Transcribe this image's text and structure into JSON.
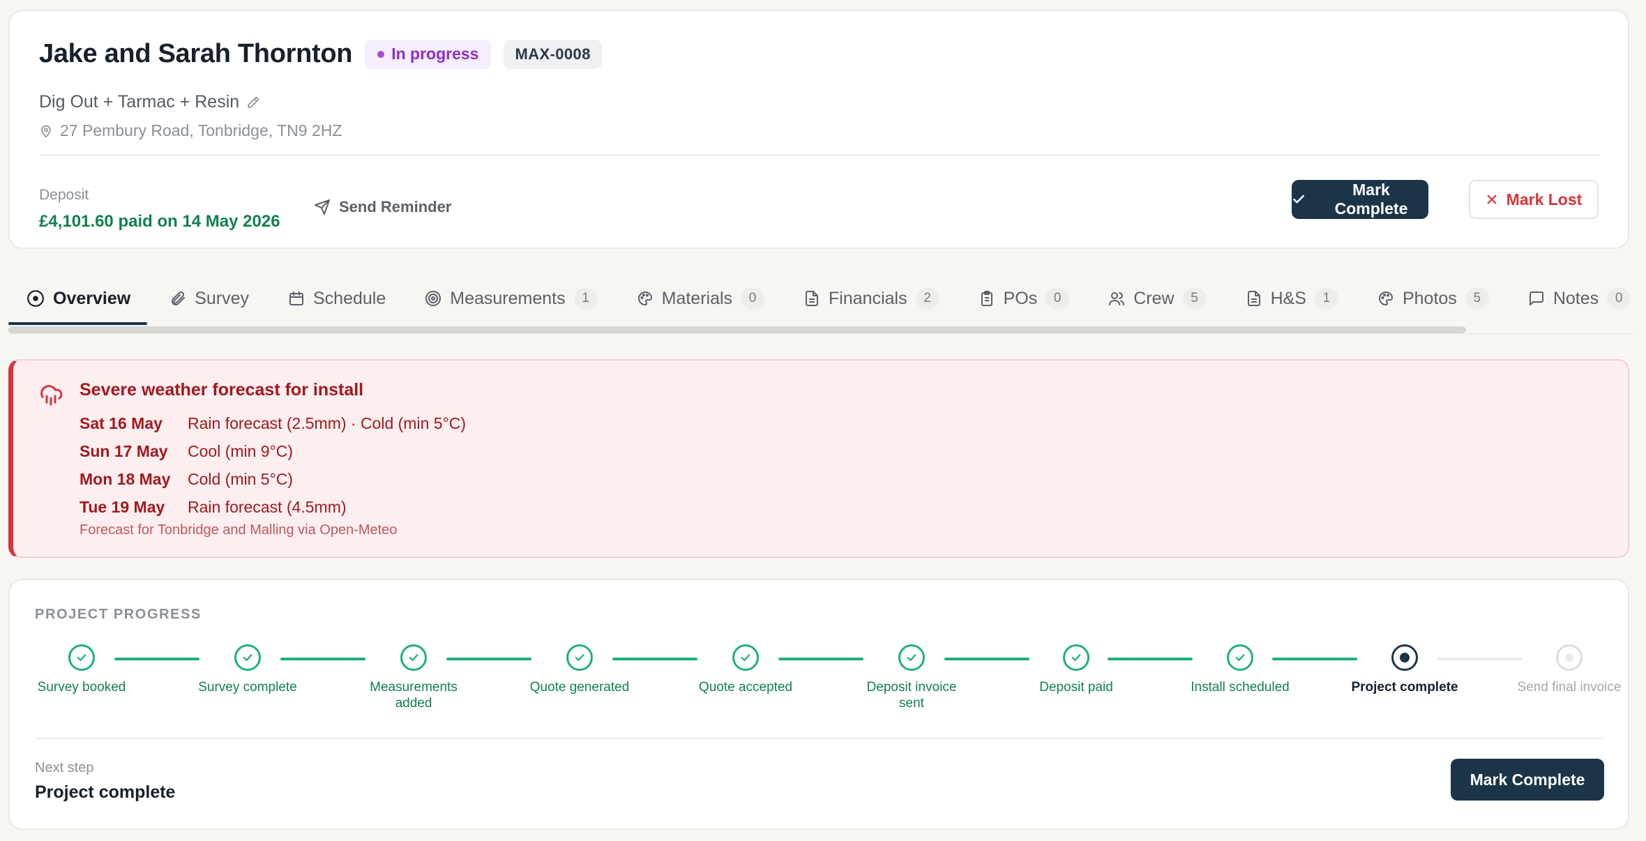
{
  "header": {
    "client_name": "Jake and Sarah Thornton",
    "status": "In progress",
    "reference": "MAX-0008",
    "job_type": "Dig Out + Tarmac + Resin",
    "address": "27 Pembury Road, Tonbridge, TN9 2HZ",
    "deposit_label": "Deposit",
    "deposit_value": "£4,101.60 paid on 14 May 2026",
    "send_reminder_label": "Send Reminder",
    "mark_complete_label": "Mark Complete",
    "mark_lost_label": "Mark Lost",
    "colors": {
      "status": "#8b2fc9",
      "deposit": "#13804f",
      "primary": "#1b3447",
      "danger": "#d8343a"
    }
  },
  "tabs": [
    {
      "label": "Overview",
      "icon": "target-circle-icon",
      "active": true
    },
    {
      "label": "Survey",
      "icon": "paperclip-icon"
    },
    {
      "label": "Schedule",
      "icon": "calendar-icon"
    },
    {
      "label": "Measurements",
      "icon": "target-icon",
      "count": "1"
    },
    {
      "label": "Materials",
      "icon": "palette-icon",
      "count": "0"
    },
    {
      "label": "Financials",
      "icon": "document-icon",
      "count": "2"
    },
    {
      "label": "POs",
      "icon": "clipboard-icon",
      "count": "0"
    },
    {
      "label": "Crew",
      "icon": "users-icon",
      "count": "5"
    },
    {
      "label": "H&S",
      "icon": "document-icon",
      "count": "1"
    },
    {
      "label": "Photos",
      "icon": "palette-icon",
      "count": "5"
    },
    {
      "label": "Notes",
      "icon": "chat-icon",
      "count": "0"
    }
  ],
  "weather_alert": {
    "title": "Severe weather forecast for install",
    "forecast": [
      {
        "day": "Sat 16 May",
        "desc": "Rain forecast (2.5mm) · Cold (min 5°C)"
      },
      {
        "day": "Sun 17 May",
        "desc": "Cool (min 9°C)"
      },
      {
        "day": "Mon 18 May",
        "desc": "Cold (min 5°C)"
      },
      {
        "day": "Tue 19 May",
        "desc": "Rain forecast (4.5mm)"
      }
    ],
    "source": "Forecast for Tonbridge and Malling via Open-Meteo"
  },
  "progress": {
    "heading": "PROJECT PROGRESS",
    "steps": [
      {
        "label": "Survey booked",
        "state": "done"
      },
      {
        "label": "Survey complete",
        "state": "done"
      },
      {
        "label": "Measurements added",
        "state": "done"
      },
      {
        "label": "Quote generated",
        "state": "done"
      },
      {
        "label": "Quote accepted",
        "state": "done"
      },
      {
        "label": "Deposit invoice sent",
        "state": "done"
      },
      {
        "label": "Deposit paid",
        "state": "done"
      },
      {
        "label": "Install scheduled",
        "state": "done"
      },
      {
        "label": "Project complete",
        "state": "current"
      },
      {
        "label": "Send final invoice",
        "state": "pending"
      }
    ],
    "next_step_label": "Next step",
    "next_step_value": "Project complete",
    "mark_complete_label": "Mark Complete"
  }
}
